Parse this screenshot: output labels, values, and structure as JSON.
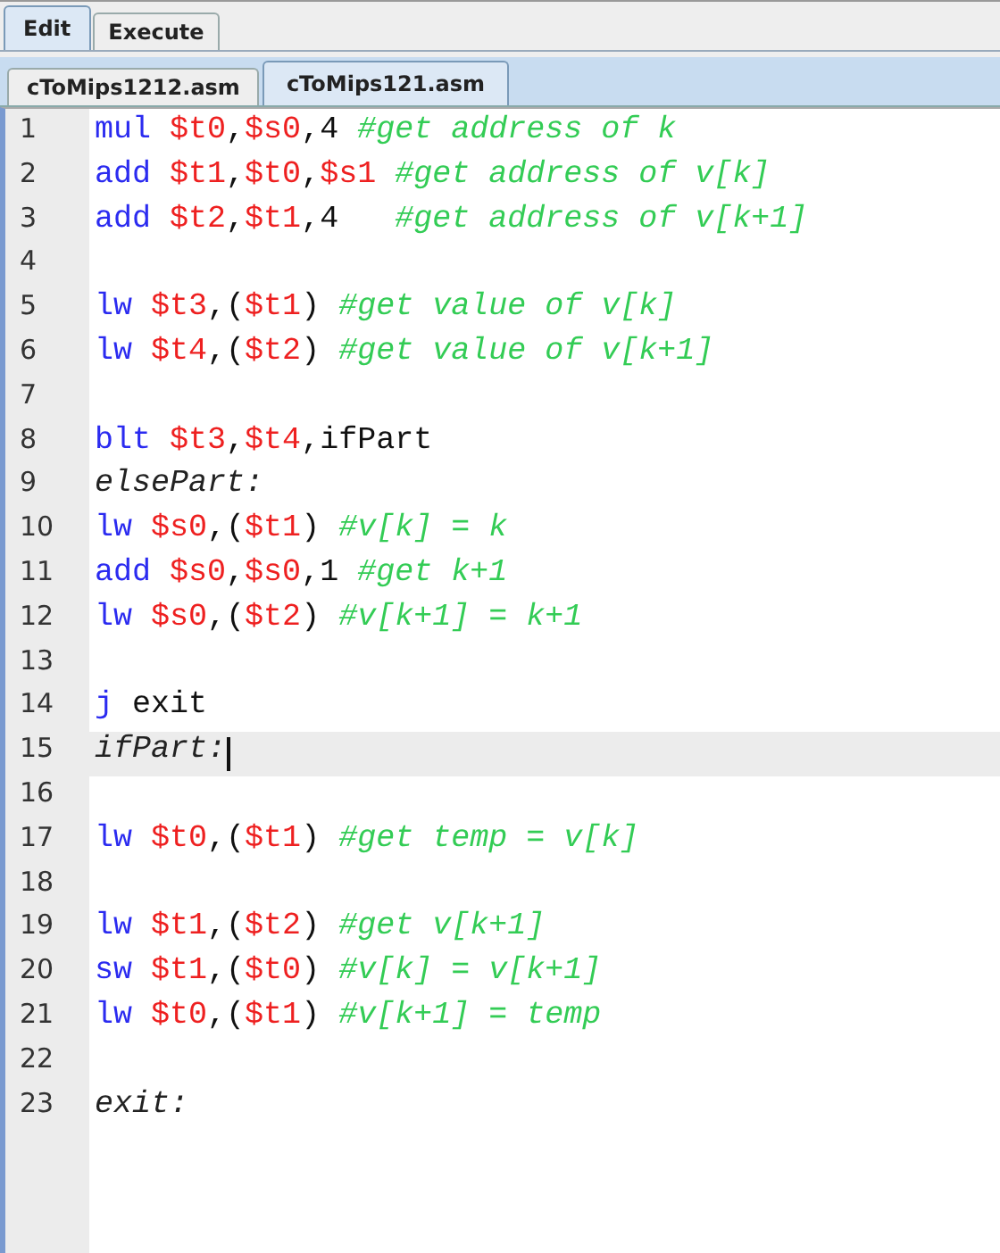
{
  "mode_tabs": [
    {
      "label": "Edit",
      "selected": true
    },
    {
      "label": "Execute",
      "selected": false
    }
  ],
  "file_tabs": [
    {
      "label": "cToMips1212.asm",
      "selected": false
    },
    {
      "label": "cToMips121.asm",
      "selected": true
    }
  ],
  "editor": {
    "lines": [
      {
        "number": "1",
        "current": false,
        "tokens": [
          {
            "kind": "op",
            "text": "mul "
          },
          {
            "kind": "reg",
            "text": "$t0"
          },
          {
            "kind": "text",
            "text": ","
          },
          {
            "kind": "reg",
            "text": "$s0"
          },
          {
            "kind": "text",
            "text": ",4 "
          },
          {
            "kind": "comment",
            "text": "#get address of k"
          }
        ]
      },
      {
        "number": "2",
        "current": false,
        "tokens": [
          {
            "kind": "op",
            "text": "add "
          },
          {
            "kind": "reg",
            "text": "$t1"
          },
          {
            "kind": "text",
            "text": ","
          },
          {
            "kind": "reg",
            "text": "$t0"
          },
          {
            "kind": "text",
            "text": ","
          },
          {
            "kind": "reg",
            "text": "$s1 "
          },
          {
            "kind": "comment",
            "text": "#get address of v[k]"
          }
        ]
      },
      {
        "number": "3",
        "current": false,
        "tokens": [
          {
            "kind": "op",
            "text": "add "
          },
          {
            "kind": "reg",
            "text": "$t2"
          },
          {
            "kind": "text",
            "text": ","
          },
          {
            "kind": "reg",
            "text": "$t1"
          },
          {
            "kind": "text",
            "text": ",4   "
          },
          {
            "kind": "comment",
            "text": "#get address of v[k+1]"
          }
        ]
      },
      {
        "number": "4",
        "current": false
      },
      {
        "number": "5",
        "current": false,
        "tokens": [
          {
            "kind": "op",
            "text": "lw "
          },
          {
            "kind": "reg",
            "text": "$t3"
          },
          {
            "kind": "text",
            "text": ",("
          },
          {
            "kind": "reg",
            "text": "$t1"
          },
          {
            "kind": "text",
            "text": ") "
          },
          {
            "kind": "comment",
            "text": "#get value of v[k]"
          }
        ]
      },
      {
        "number": "6",
        "current": false,
        "tokens": [
          {
            "kind": "op",
            "text": "lw "
          },
          {
            "kind": "reg",
            "text": "$t4"
          },
          {
            "kind": "text",
            "text": ",("
          },
          {
            "kind": "reg",
            "text": "$t2"
          },
          {
            "kind": "text",
            "text": ") "
          },
          {
            "kind": "comment",
            "text": "#get value of v[k+1]"
          }
        ]
      },
      {
        "number": "7",
        "current": false
      },
      {
        "number": "8",
        "current": false,
        "tokens": [
          {
            "kind": "op",
            "text": "blt "
          },
          {
            "kind": "reg",
            "text": "$t3"
          },
          {
            "kind": "text",
            "text": ","
          },
          {
            "kind": "reg",
            "text": "$t4"
          },
          {
            "kind": "text",
            "text": ",ifPart"
          }
        ]
      },
      {
        "number": "9",
        "current": false,
        "tokens": [
          {
            "kind": "label",
            "text": "elsePart:"
          }
        ]
      },
      {
        "number": "10",
        "current": false,
        "tokens": [
          {
            "kind": "op",
            "text": "lw "
          },
          {
            "kind": "reg",
            "text": "$s0"
          },
          {
            "kind": "text",
            "text": ",("
          },
          {
            "kind": "reg",
            "text": "$t1"
          },
          {
            "kind": "text",
            "text": ") "
          },
          {
            "kind": "comment",
            "text": "#v[k] = k"
          }
        ]
      },
      {
        "number": "11",
        "current": false,
        "tokens": [
          {
            "kind": "op",
            "text": "add "
          },
          {
            "kind": "reg",
            "text": "$s0"
          },
          {
            "kind": "text",
            "text": ","
          },
          {
            "kind": "reg",
            "text": "$s0"
          },
          {
            "kind": "text",
            "text": ",1 "
          },
          {
            "kind": "comment",
            "text": "#get k+1"
          }
        ]
      },
      {
        "number": "12",
        "current": false,
        "tokens": [
          {
            "kind": "op",
            "text": "lw "
          },
          {
            "kind": "reg",
            "text": "$s0"
          },
          {
            "kind": "text",
            "text": ",("
          },
          {
            "kind": "reg",
            "text": "$t2"
          },
          {
            "kind": "text",
            "text": ") "
          },
          {
            "kind": "comment",
            "text": "#v[k+1] = k+1"
          }
        ]
      },
      {
        "number": "13",
        "current": false
      },
      {
        "number": "14",
        "current": false,
        "tokens": [
          {
            "kind": "op",
            "text": "j "
          },
          {
            "kind": "text",
            "text": "exit"
          }
        ]
      },
      {
        "number": "15",
        "current": true,
        "tokens": [
          {
            "kind": "label",
            "text": "ifPart:"
          }
        ]
      },
      {
        "number": "16",
        "current": false
      },
      {
        "number": "17",
        "current": false,
        "tokens": [
          {
            "kind": "op",
            "text": "lw "
          },
          {
            "kind": "reg",
            "text": "$t0"
          },
          {
            "kind": "text",
            "text": ",("
          },
          {
            "kind": "reg",
            "text": "$t1"
          },
          {
            "kind": "text",
            "text": ") "
          },
          {
            "kind": "comment",
            "text": "#get temp = v[k]"
          }
        ]
      },
      {
        "number": "18",
        "current": false
      },
      {
        "number": "19",
        "current": false,
        "tokens": [
          {
            "kind": "op",
            "text": "lw "
          },
          {
            "kind": "reg",
            "text": "$t1"
          },
          {
            "kind": "text",
            "text": ",("
          },
          {
            "kind": "reg",
            "text": "$t2"
          },
          {
            "kind": "text",
            "text": ") "
          },
          {
            "kind": "comment",
            "text": "#get v[k+1]"
          }
        ]
      },
      {
        "number": "20",
        "current": false,
        "tokens": [
          {
            "kind": "op",
            "text": "sw "
          },
          {
            "kind": "reg",
            "text": "$t1"
          },
          {
            "kind": "text",
            "text": ",("
          },
          {
            "kind": "reg",
            "text": "$t0"
          },
          {
            "kind": "text",
            "text": ") "
          },
          {
            "kind": "comment",
            "text": "#v[k] = v[k+1]"
          }
        ]
      },
      {
        "number": "21",
        "current": false,
        "tokens": [
          {
            "kind": "op",
            "text": "lw "
          },
          {
            "kind": "reg",
            "text": "$t0"
          },
          {
            "kind": "text",
            "text": ",("
          },
          {
            "kind": "reg",
            "text": "$t1"
          },
          {
            "kind": "text",
            "text": ") "
          },
          {
            "kind": "comment",
            "text": "#v[k+1] = temp"
          }
        ]
      },
      {
        "number": "22",
        "current": false
      },
      {
        "number": "23",
        "current": false,
        "tokens": [
          {
            "kind": "label",
            "text": "exit:"
          }
        ]
      }
    ]
  }
}
